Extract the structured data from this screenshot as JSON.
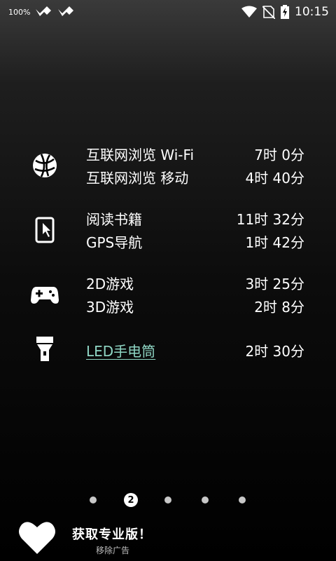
{
  "status_bar": {
    "battery_percent_text": "100%",
    "time": "10:15",
    "icons": [
      "notification-app-icon",
      "notification-app-icon",
      "wifi-icon",
      "no-sim-icon",
      "battery-charging-icon"
    ]
  },
  "groups": [
    {
      "icon": "globe-icon",
      "rows": [
        {
          "label": "互联网浏览 Wi-Fi",
          "duration": "7时 0分"
        },
        {
          "label": "互联网浏览 移动",
          "duration": "4时 40分"
        }
      ]
    },
    {
      "icon": "tablet-touch-icon",
      "rows": [
        {
          "label": "阅读书籍",
          "duration": "11时 32分"
        },
        {
          "label": "GPS导航",
          "duration": "1时 42分"
        }
      ]
    },
    {
      "icon": "gamepad-icon",
      "rows": [
        {
          "label": "2D游戏",
          "duration": "3时 25分"
        },
        {
          "label": "3D游戏",
          "duration": "2时 8分"
        }
      ]
    },
    {
      "icon": "flashlight-icon",
      "rows": [
        {
          "label": "LED手电筒",
          "duration": "2时 30分"
        }
      ]
    }
  ],
  "pager": {
    "active_page_label": "2",
    "page_count": 5,
    "active_index": 1
  },
  "promo": {
    "title": "获取专业版！",
    "subtitle": "移除广告",
    "icon": "heart-icon"
  },
  "colors": {
    "link": "#8fd6c4",
    "background_top": "#3a3a3a",
    "background_bottom": "#000000"
  }
}
